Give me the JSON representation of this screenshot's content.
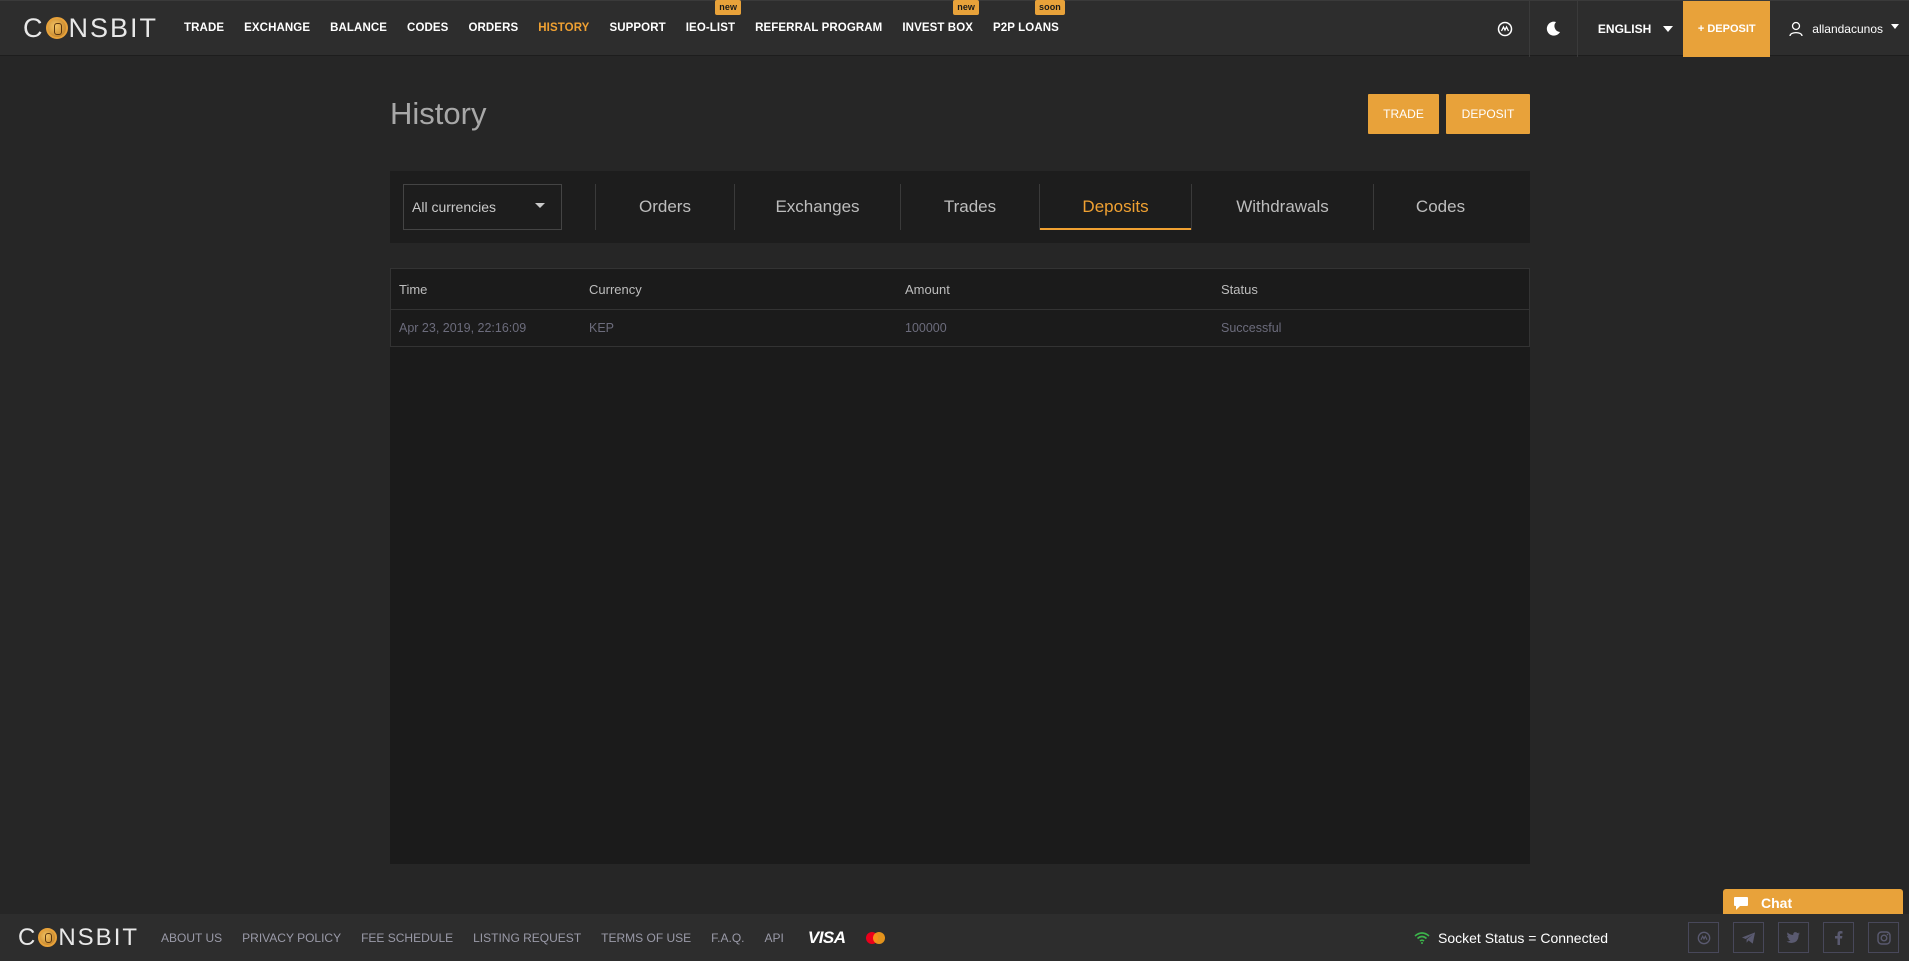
{
  "brand": {
    "logo_pre": "C",
    "logo_post": "NSBIT"
  },
  "nav": {
    "items": [
      {
        "label": "TRADE",
        "active": false,
        "badge": ""
      },
      {
        "label": "EXCHANGE",
        "active": false,
        "badge": ""
      },
      {
        "label": "BALANCE",
        "active": false,
        "badge": ""
      },
      {
        "label": "CODES",
        "active": false,
        "badge": ""
      },
      {
        "label": "ORDERS",
        "active": false,
        "badge": ""
      },
      {
        "label": "HISTORY",
        "active": true,
        "badge": ""
      },
      {
        "label": "SUPPORT",
        "active": false,
        "badge": ""
      },
      {
        "label": "IEO-LIST",
        "active": false,
        "badge": "new"
      },
      {
        "label": "REFERRAL PROGRAM",
        "active": false,
        "badge": ""
      },
      {
        "label": "INVEST BOX",
        "active": false,
        "badge": "new"
      },
      {
        "label": "P2P LOANS",
        "active": false,
        "badge": "soon"
      }
    ],
    "language": "ENGLISH",
    "deposit_label": "+ DEPOSIT",
    "username": "allandacunos"
  },
  "page": {
    "title": "History",
    "trade_button": "TRADE",
    "deposit_button": "DEPOSIT"
  },
  "filters": {
    "currency_selected": "All currencies",
    "tabs": [
      "Orders",
      "Exchanges",
      "Trades",
      "Deposits",
      "Withdrawals",
      "Codes"
    ],
    "active_tab": "Deposits"
  },
  "table": {
    "headers": [
      "Time",
      "Currency",
      "Amount",
      "Status"
    ],
    "rows": [
      [
        "Apr 23, 2019, 22:16:09",
        "KEP",
        "100000",
        "Successful"
      ]
    ]
  },
  "footer": {
    "links": [
      "ABOUT US",
      "PRIVACY POLICY",
      "FEE SCHEDULE",
      "LISTING REQUEST",
      "TERMS OF USE",
      "F.A.Q.",
      "API"
    ],
    "visa": "VISA",
    "socket_status": "Socket Status = Connected",
    "socials": [
      "coinmarketcap-icon",
      "telegram-icon",
      "twitter-icon",
      "facebook-icon",
      "instagram-icon"
    ]
  },
  "chat": {
    "label": "Chat"
  },
  "colors": {
    "accent": "#e8a23a",
    "bg": "#262626",
    "panel": "#1d1d1d",
    "socket_ok": "#3cb44b"
  }
}
